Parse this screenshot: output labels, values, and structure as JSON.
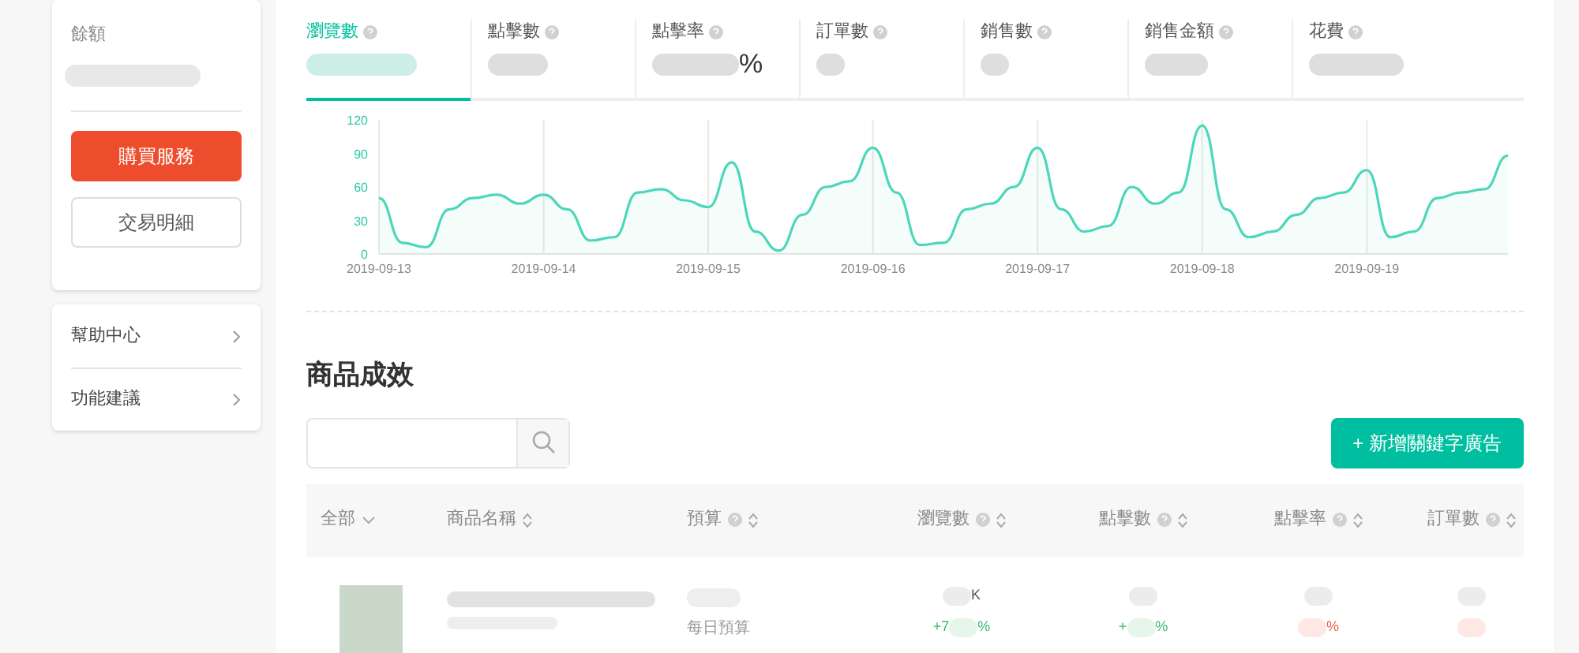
{
  "sidebar": {
    "balance_label": "餘額",
    "buttons": [
      {
        "label": "購買服務",
        "kind": "primary"
      },
      {
        "label": "交易明細",
        "kind": "secondary"
      }
    ],
    "links": [
      {
        "label": "幫助中心"
      },
      {
        "label": "功能建議"
      }
    ]
  },
  "metrics": [
    {
      "label": "瀏覽數",
      "selected": true
    },
    {
      "label": "點擊數",
      "selected": false
    },
    {
      "label": "點擊率",
      "selected": false,
      "suffix": "%"
    },
    {
      "label": "訂單數",
      "selected": false
    },
    {
      "label": "銷售數",
      "selected": false
    },
    {
      "label": "銷售金額",
      "selected": false
    },
    {
      "label": "花費",
      "selected": false
    }
  ],
  "chart_data": {
    "type": "area",
    "categories": [
      "2019-09-13",
      null,
      null,
      null,
      null,
      null,
      null,
      "2019-09-14",
      null,
      null,
      null,
      null,
      null,
      null,
      "2019-09-15",
      null,
      null,
      null,
      null,
      null,
      null,
      "2019-09-16",
      null,
      null,
      null,
      null,
      null,
      null,
      "2019-09-17",
      null,
      null,
      null,
      null,
      null,
      null,
      "2019-09-18",
      null,
      null,
      null,
      null,
      null,
      null,
      "2019-09-19",
      null,
      null,
      null,
      null,
      null,
      null
    ],
    "series": [
      {
        "color": "#4dd6bc",
        "values": [
          50,
          10,
          6,
          40,
          50,
          53,
          45,
          53,
          40,
          12,
          15,
          55,
          58,
          48,
          42,
          82,
          20,
          3,
          35,
          60,
          65,
          95,
          55,
          8,
          10,
          40,
          45,
          60,
          95,
          40,
          20,
          25,
          60,
          45,
          55,
          115,
          40,
          15,
          20,
          35,
          50,
          55,
          75,
          15,
          20,
          50,
          55,
          58,
          88
        ]
      }
    ],
    "ylim": [
      0,
      120
    ],
    "yticks": [
      0,
      30,
      60,
      90,
      120
    ],
    "grid": true
  },
  "products": {
    "title": "商品成效",
    "add_button": "+ 新增關鍵字廣告",
    "columns": [
      {
        "label": "全部",
        "kind": "filter"
      },
      {
        "label": "商品名稱",
        "kind": "sort"
      },
      {
        "label": "預算",
        "kind": "help_sort"
      },
      {
        "label": "瀏覽數",
        "kind": "help_sort"
      },
      {
        "label": "點擊數",
        "kind": "help_sort"
      },
      {
        "label": "點擊率",
        "kind": "help_sort"
      },
      {
        "label": "訂單數",
        "kind": "help_sort"
      }
    ],
    "rows": [
      {
        "budget_note": "每日預算",
        "views_suffix": "K",
        "views_change": "+7",
        "views_change_suffix": "%",
        "clicks_change": "+",
        "clicks_change_suffix": "%",
        "ctr_change_suffix": "%"
      }
    ]
  }
}
